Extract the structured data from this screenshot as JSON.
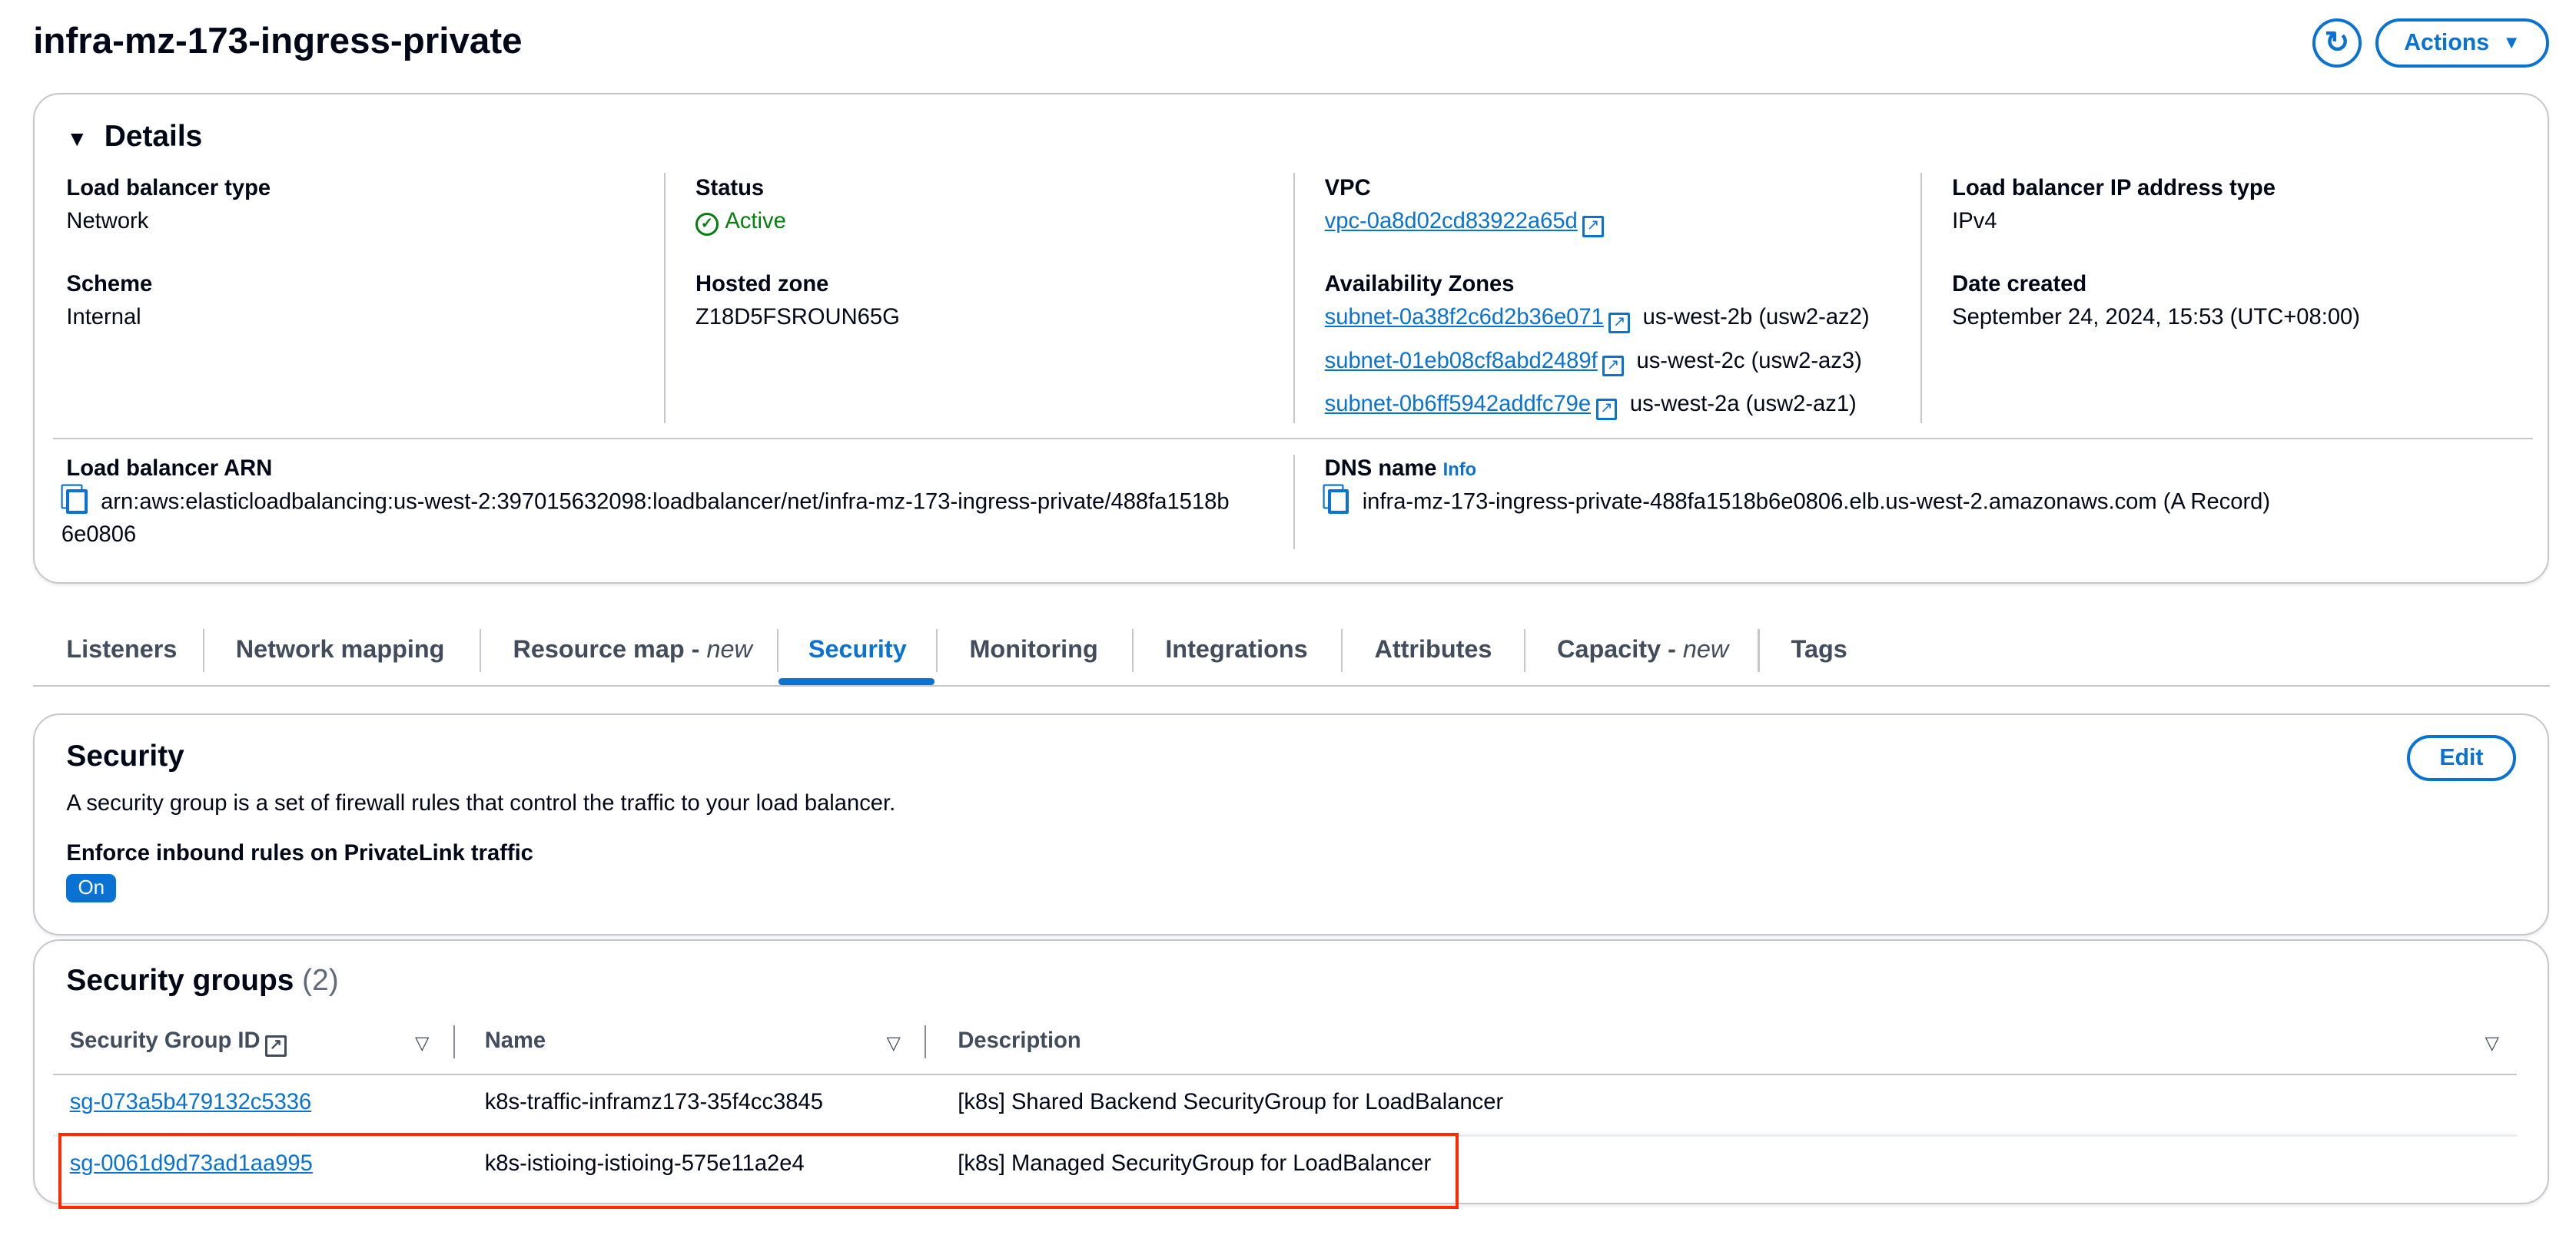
{
  "page": {
    "title": "infra-mz-173-ingress-private",
    "refresh_icon": "refresh-icon",
    "actions_label": "Actions"
  },
  "details": {
    "heading": "Details",
    "lb_type_label": "Load balancer type",
    "lb_type": "Network",
    "scheme_label": "Scheme",
    "scheme": "Internal",
    "status_label": "Status",
    "status": "Active",
    "status_color": "#037f0c",
    "hosted_zone_label": "Hosted zone",
    "hosted_zone": "Z18D5FSROUN65G",
    "vpc_label": "VPC",
    "vpc": "vpc-0a8d02cd83922a65d",
    "az_label": "Availability Zones",
    "azs": [
      {
        "subnet": "subnet-0a38f2c6d2b36e071",
        "zone": "us-west-2b (usw2-az2)"
      },
      {
        "subnet": "subnet-01eb08cf8abd2489f",
        "zone": "us-west-2c (usw2-az3)"
      },
      {
        "subnet": "subnet-0b6ff5942addfc79e",
        "zone": "us-west-2a (usw2-az1)"
      }
    ],
    "ip_type_label": "Load balancer IP address type",
    "ip_type": "IPv4",
    "date_label": "Date created",
    "date": "September 24, 2024, 15:53 (UTC+08:00)",
    "arn_label": "Load balancer ARN",
    "arn_line1": "arn:aws:elasticloadbalancing:us-west-2:397015632098:loadbalancer/net/infra-mz-173-ingress-private/488fa1518b",
    "arn_line2": "6e0806",
    "dns_label": "DNS name",
    "dns_info": "Info",
    "dns": "infra-mz-173-ingress-private-488fa1518b6e0806.elb.us-west-2.amazonaws.com (A Record)"
  },
  "tabs": [
    {
      "label": "Listeners"
    },
    {
      "label": "Network mapping"
    },
    {
      "label": "Resource map - ",
      "em": "new"
    },
    {
      "label": "Security",
      "active": true
    },
    {
      "label": "Monitoring"
    },
    {
      "label": "Integrations"
    },
    {
      "label": "Attributes"
    },
    {
      "label": "Capacity - ",
      "em": "new"
    },
    {
      "label": "Tags"
    }
  ],
  "security": {
    "heading": "Security",
    "description": "A security group is a set of firewall rules that control the traffic to your load balancer.",
    "enforce_label": "Enforce inbound rules on PrivateLink traffic",
    "enforce_value": "On",
    "edit_label": "Edit"
  },
  "security_groups": {
    "heading": "Security groups",
    "count": "(2)",
    "columns": [
      "Security Group ID",
      "Name",
      "Description"
    ],
    "rows": [
      {
        "id": "sg-073a5b479132c5336",
        "name": "k8s-traffic-inframz173-35f4cc3845",
        "description": "[k8s] Shared Backend SecurityGroup for LoadBalancer"
      },
      {
        "id": "sg-0061d9d73ad1aa995",
        "name": "k8s-istioing-istioing-575e11a2e4",
        "description": "[k8s] Managed SecurityGroup for LoadBalancer",
        "highlighted": true
      }
    ],
    "highlight_color": "#ff2a00"
  },
  "colors": {
    "accent": "#0972d3",
    "success": "#037f0c"
  }
}
